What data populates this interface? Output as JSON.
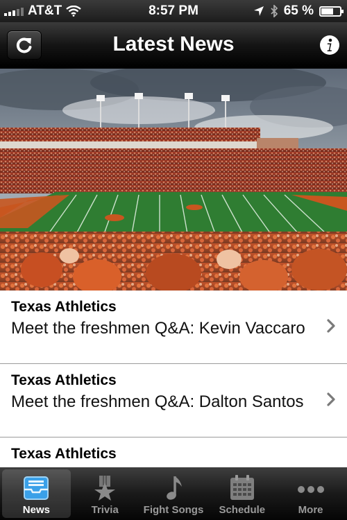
{
  "status_bar": {
    "carrier": "AT&T",
    "time": "8:57 PM",
    "battery_percent": "65 %",
    "battery_level": 0.65
  },
  "nav": {
    "title": "Latest News"
  },
  "news": [
    {
      "source": "Texas Athletics",
      "title": "Meet the freshmen Q&A: Kevin Vaccaro"
    },
    {
      "source": "Texas Athletics",
      "title": "Meet the freshmen Q&A: Dalton Santos"
    },
    {
      "source": "Texas Athletics",
      "title": ""
    }
  ],
  "tabs": [
    {
      "label": "News",
      "icon": "news-tray-icon",
      "active": true
    },
    {
      "label": "Trivia",
      "icon": "star-icon",
      "active": false
    },
    {
      "label": "Fight Songs",
      "icon": "music-note-icon",
      "active": false
    },
    {
      "label": "Schedule",
      "icon": "calendar-icon",
      "active": false
    },
    {
      "label": "More",
      "icon": "more-dots-icon",
      "active": false
    }
  ],
  "colors": {
    "burnt_orange": "#c8561f",
    "field_green": "#2f7d32",
    "active_tab_blue": "#3aa0e8"
  }
}
